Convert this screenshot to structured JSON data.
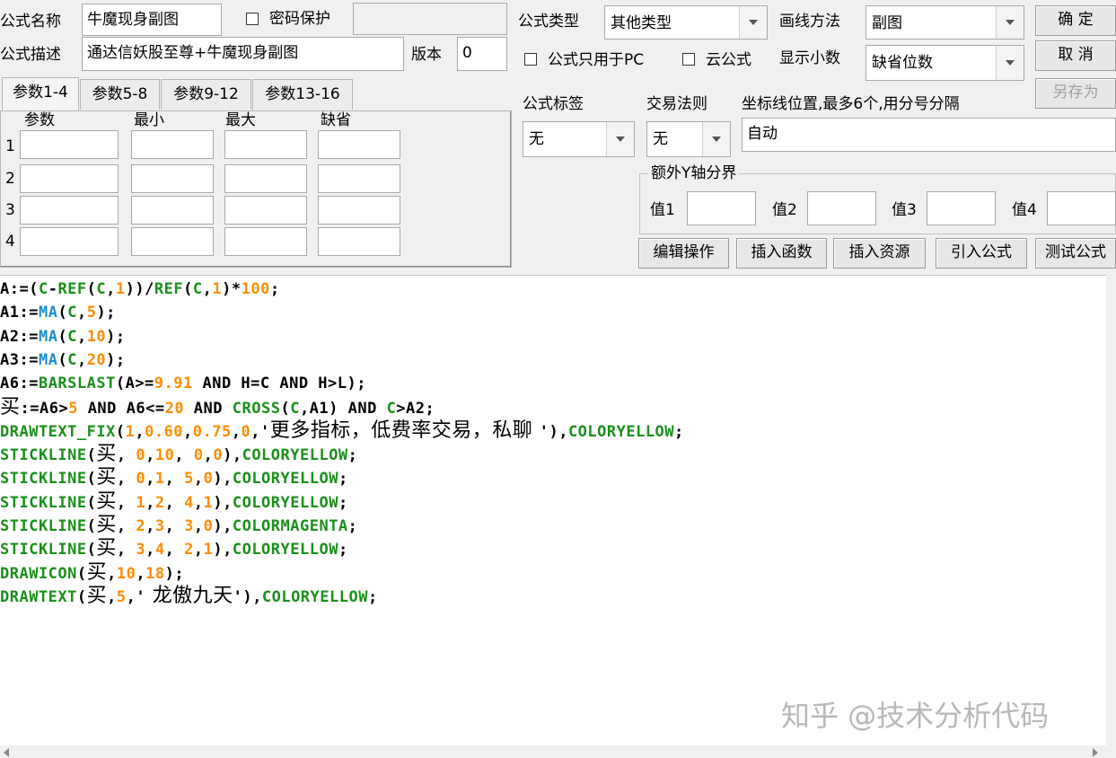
{
  "header": {
    "name_label": "公式名称",
    "name_value": "牛魔现身副图",
    "password_label": "密码保护",
    "desc_label": "公式描述",
    "desc_value": "通达信妖股至尊+牛魔现身副图",
    "version_label": "版本",
    "version_value": "0",
    "type_label": "公式类型",
    "type_value": "其他类型",
    "draw_label": "画线方法",
    "draw_value": "副图",
    "pc_only_label": "公式只用于PC",
    "cloud_label": "云公式",
    "decimals_label": "显示小数",
    "decimals_value": "缺省位数"
  },
  "buttons": {
    "ok": "确  定",
    "cancel": "取  消",
    "save_as": "另存为",
    "edit": "编辑操作",
    "insert_func": "插入函数",
    "insert_res": "插入资源",
    "import": "引入公式",
    "test": "测试公式"
  },
  "tabs": [
    "参数1-4",
    "参数5-8",
    "参数9-12",
    "参数13-16"
  ],
  "param_grid": {
    "headers": [
      "参数",
      "最小",
      "最大",
      "缺省"
    ],
    "rows": [
      "1",
      "2",
      "3",
      "4"
    ]
  },
  "right_panel": {
    "tag_label": "公式标签",
    "tag_value": "无",
    "rule_label": "交易法则",
    "rule_value": "无",
    "coord_label": "坐标线位置,最多6个,用分号分隔",
    "coord_value": "自动",
    "yaxis_group": "额外Y轴分界",
    "v1": "值1",
    "v2": "值2",
    "v3": "值3",
    "v4": "值4"
  },
  "code": [
    [
      [
        "A:=(",
        "k"
      ],
      [
        "C",
        "g"
      ],
      [
        "-",
        "k"
      ],
      [
        "REF",
        "g"
      ],
      [
        "(",
        "k"
      ],
      [
        "C",
        "g"
      ],
      [
        ",",
        "k"
      ],
      [
        "1",
        "n"
      ],
      [
        "))/",
        "k"
      ],
      [
        "REF",
        "g"
      ],
      [
        "(",
        "k"
      ],
      [
        "C",
        "g"
      ],
      [
        ",",
        "k"
      ],
      [
        "1",
        "n"
      ],
      [
        ")*",
        "k"
      ],
      [
        "100",
        "n"
      ],
      [
        ";",
        "k"
      ]
    ],
    [
      [
        "A1:=",
        "k"
      ],
      [
        "MA",
        "f"
      ],
      [
        "(",
        "k"
      ],
      [
        "C",
        "g"
      ],
      [
        ",",
        "k"
      ],
      [
        "5",
        "n"
      ],
      [
        ");",
        "k"
      ]
    ],
    [
      [
        "A2:=",
        "k"
      ],
      [
        "MA",
        "f"
      ],
      [
        "(",
        "k"
      ],
      [
        "C",
        "g"
      ],
      [
        ",",
        "k"
      ],
      [
        "10",
        "n"
      ],
      [
        ");",
        "k"
      ]
    ],
    [
      [
        "A3:=",
        "k"
      ],
      [
        "MA",
        "f"
      ],
      [
        "(",
        "k"
      ],
      [
        "C",
        "g"
      ],
      [
        ",",
        "k"
      ],
      [
        "20",
        "n"
      ],
      [
        ");",
        "k"
      ]
    ],
    [
      [
        "A6:=",
        "k"
      ],
      [
        "BARSLAST",
        "g"
      ],
      [
        "(A>=",
        "k"
      ],
      [
        "9.91",
        "n"
      ],
      [
        " AND H=C AND H>L);",
        "k"
      ]
    ],
    [
      [
        "买",
        "cn"
      ],
      [
        ":=A6>",
        "k"
      ],
      [
        "5",
        "n"
      ],
      [
        " AND A6<=",
        "k"
      ],
      [
        "20",
        "n"
      ],
      [
        " AND ",
        "k"
      ],
      [
        "CROSS",
        "g"
      ],
      [
        "(",
        "k"
      ],
      [
        "C",
        "g"
      ],
      [
        ",A1) AND ",
        "k"
      ],
      [
        "C",
        "g"
      ],
      [
        ">A2;",
        "k"
      ]
    ],
    [
      [
        "DRAWTEXT_FIX",
        "g"
      ],
      [
        "(",
        "k"
      ],
      [
        "1",
        "n"
      ],
      [
        ",",
        "k"
      ],
      [
        "0.60",
        "n"
      ],
      [
        ",",
        "k"
      ],
      [
        "0.75",
        "n"
      ],
      [
        ",",
        "k"
      ],
      [
        "0",
        "n"
      ],
      [
        ",'",
        "k"
      ],
      [
        "更多指标，低费率交易，私聊 ",
        "cn"
      ],
      [
        "'),",
        "k"
      ],
      [
        "COLORYELLOW",
        "g"
      ],
      [
        ";",
        "k"
      ]
    ],
    [
      [
        "STICKLINE",
        "g"
      ],
      [
        "(",
        "k"
      ],
      [
        "买",
        "cn"
      ],
      [
        ", ",
        "k"
      ],
      [
        "0",
        "n"
      ],
      [
        ",",
        "k"
      ],
      [
        "10",
        "n"
      ],
      [
        ", ",
        "k"
      ],
      [
        "0",
        "n"
      ],
      [
        ",",
        "k"
      ],
      [
        "0",
        "n"
      ],
      [
        "),",
        "k"
      ],
      [
        "COLORYELLOW",
        "g"
      ],
      [
        ";",
        "k"
      ]
    ],
    [
      [
        "STICKLINE",
        "g"
      ],
      [
        "(",
        "k"
      ],
      [
        "买",
        "cn"
      ],
      [
        ", ",
        "k"
      ],
      [
        "0",
        "n"
      ],
      [
        ",",
        "k"
      ],
      [
        "1",
        "n"
      ],
      [
        ", ",
        "k"
      ],
      [
        "5",
        "n"
      ],
      [
        ",",
        "k"
      ],
      [
        "0",
        "n"
      ],
      [
        "),",
        "k"
      ],
      [
        "COLORYELLOW",
        "g"
      ],
      [
        ";",
        "k"
      ]
    ],
    [
      [
        "STICKLINE",
        "g"
      ],
      [
        "(",
        "k"
      ],
      [
        "买",
        "cn"
      ],
      [
        ", ",
        "k"
      ],
      [
        "1",
        "n"
      ],
      [
        ",",
        "k"
      ],
      [
        "2",
        "n"
      ],
      [
        ", ",
        "k"
      ],
      [
        "4",
        "n"
      ],
      [
        ",",
        "k"
      ],
      [
        "1",
        "n"
      ],
      [
        "),",
        "k"
      ],
      [
        "COLORYELLOW",
        "g"
      ],
      [
        ";",
        "k"
      ]
    ],
    [
      [
        "STICKLINE",
        "g"
      ],
      [
        "(",
        "k"
      ],
      [
        "买",
        "cn"
      ],
      [
        ", ",
        "k"
      ],
      [
        "2",
        "n"
      ],
      [
        ",",
        "k"
      ],
      [
        "3",
        "n"
      ],
      [
        ", ",
        "k"
      ],
      [
        "3",
        "n"
      ],
      [
        ",",
        "k"
      ],
      [
        "0",
        "n"
      ],
      [
        "),",
        "k"
      ],
      [
        "COLORMAGENTA",
        "g"
      ],
      [
        ";",
        "k"
      ]
    ],
    [
      [
        "STICKLINE",
        "g"
      ],
      [
        "(",
        "k"
      ],
      [
        "买",
        "cn"
      ],
      [
        ", ",
        "k"
      ],
      [
        "3",
        "n"
      ],
      [
        ",",
        "k"
      ],
      [
        "4",
        "n"
      ],
      [
        ", ",
        "k"
      ],
      [
        "2",
        "n"
      ],
      [
        ",",
        "k"
      ],
      [
        "1",
        "n"
      ],
      [
        "),",
        "k"
      ],
      [
        "COLORYELLOW",
        "g"
      ],
      [
        ";",
        "k"
      ]
    ],
    [
      [
        "DRAWICON",
        "g"
      ],
      [
        "(",
        "k"
      ],
      [
        "买",
        "cn"
      ],
      [
        ",",
        "k"
      ],
      [
        "10",
        "n"
      ],
      [
        ",",
        "k"
      ],
      [
        "18",
        "n"
      ],
      [
        ");",
        "k"
      ]
    ],
    [
      [
        "DRAWTEXT",
        "g"
      ],
      [
        "(",
        "k"
      ],
      [
        "买",
        "cn"
      ],
      [
        ",",
        "k"
      ],
      [
        "5",
        "n"
      ],
      [
        ",'",
        "k"
      ],
      [
        " 龙傲九天",
        "cn"
      ],
      [
        "'),",
        "k"
      ],
      [
        "COLORYELLOW",
        "g"
      ],
      [
        ";",
        "k"
      ]
    ]
  ],
  "watermark": "知乎 @技术分析代码"
}
